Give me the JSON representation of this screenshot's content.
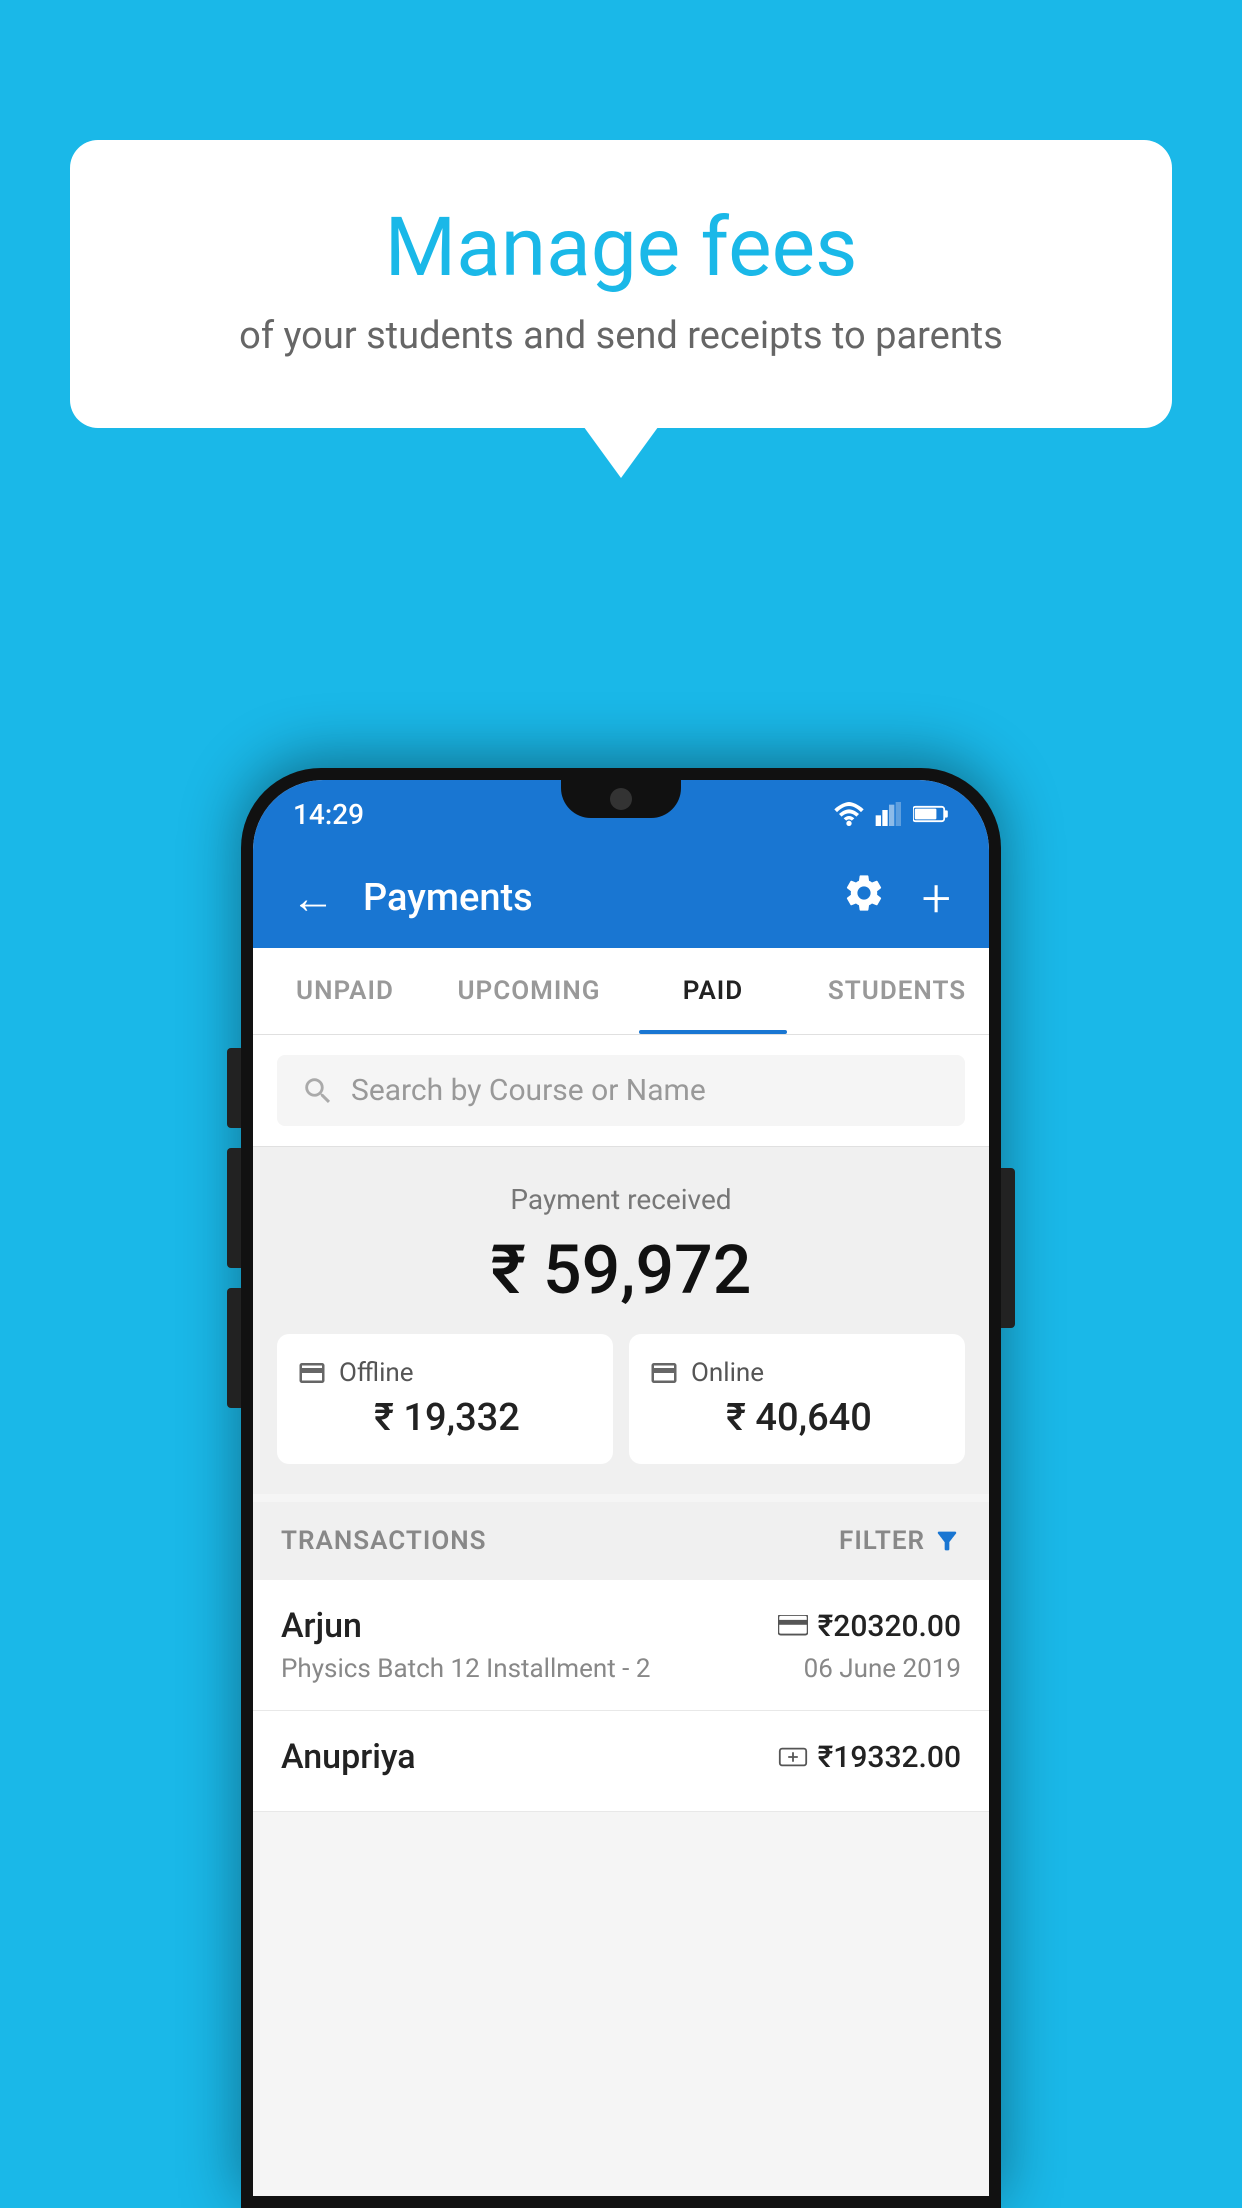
{
  "background_color": "#1ab8e8",
  "bubble": {
    "title": "Manage fees",
    "subtitle": "of your students and send receipts to parents"
  },
  "status_bar": {
    "time": "14:29"
  },
  "app_bar": {
    "title": "Payments",
    "back_icon": "←",
    "settings_icon": "⚙",
    "add_icon": "+"
  },
  "tabs": [
    {
      "label": "UNPAID",
      "active": false
    },
    {
      "label": "UPCOMING",
      "active": false
    },
    {
      "label": "PAID",
      "active": true
    },
    {
      "label": "STUDENTS",
      "active": false
    }
  ],
  "search": {
    "placeholder": "Search by Course or Name"
  },
  "payment_summary": {
    "label": "Payment received",
    "total": "₹ 59,972",
    "offline_label": "Offline",
    "offline_amount": "₹ 19,332",
    "online_label": "Online",
    "online_amount": "₹ 40,640"
  },
  "transactions": {
    "header_label": "TRANSACTIONS",
    "filter_label": "FILTER",
    "rows": [
      {
        "name": "Arjun",
        "course": "Physics Batch 12 Installment - 2",
        "amount": "₹20320.00",
        "date": "06 June 2019",
        "payment_type": "online"
      },
      {
        "name": "Anupriya",
        "course": "",
        "amount": "₹19332.00",
        "date": "",
        "payment_type": "offline"
      }
    ]
  }
}
